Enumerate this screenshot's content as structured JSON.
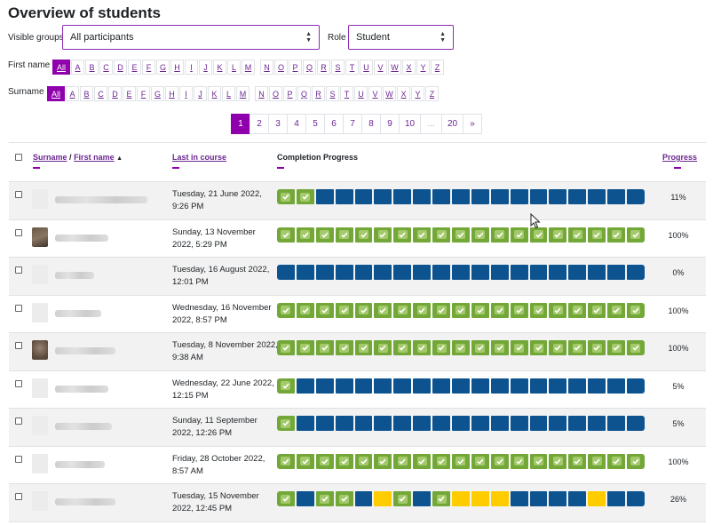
{
  "page": {
    "title": "Overview of students"
  },
  "filters": {
    "groups_label": "Visible groups",
    "groups_value": "All participants",
    "role_label": "Role",
    "role_value": "Student"
  },
  "initials": {
    "firstname_label": "First name",
    "surname_label": "Surname",
    "all_label": "All",
    "letters": [
      "A",
      "B",
      "C",
      "D",
      "E",
      "F",
      "G",
      "H",
      "I",
      "J",
      "K",
      "L",
      "M",
      "N",
      "O",
      "P",
      "Q",
      "R",
      "S",
      "T",
      "U",
      "V",
      "W",
      "X",
      "Y",
      "Z"
    ]
  },
  "pagination": {
    "pages": [
      "1",
      "2",
      "3",
      "4",
      "5",
      "6",
      "7",
      "8",
      "9",
      "10",
      "...",
      "20",
      "»"
    ],
    "active": "1"
  },
  "table": {
    "col_surname": "Surname",
    "col_sep": "/",
    "col_firstname": "First name",
    "col_last": "Last in course",
    "col_completion": "Completion Progress",
    "col_progress": "Progress",
    "rows": [
      {
        "date": "Tuesday, 21 June 2022, 9:26 PM",
        "progress": "11%",
        "segments": "CCNNNNNNNNNNNNNNNNN",
        "avatar": "blank"
      },
      {
        "date": "Sunday, 13 November 2022, 5:29 PM",
        "progress": "100%",
        "segments": "CCCCCCCCCCCCCCCCCCC",
        "avatar": "photo"
      },
      {
        "date": "Tuesday, 16 August 2022, 12:01 PM",
        "progress": "0%",
        "segments": "NNNNNNNNNNNNNNNNNNN",
        "avatar": "blank"
      },
      {
        "date": "Wednesday, 16 November 2022, 8:57 PM",
        "progress": "100%",
        "segments": "CCCCCCCCCCCCCCCCCCC",
        "avatar": "blank"
      },
      {
        "date": "Tuesday, 8 November 2022, 9:38 AM",
        "progress": "100%",
        "segments": "CCCCCCCCCCCCCCCCCCC",
        "avatar": "photo"
      },
      {
        "date": "Wednesday, 22 June 2022, 12:15 PM",
        "progress": "5%",
        "segments": "CNNNNNNNNNNNNNNNNNN",
        "avatar": "blank"
      },
      {
        "date": "Sunday, 11 September 2022, 12:26 PM",
        "progress": "5%",
        "segments": "CNNNNNNNNNNNNNNNNNN",
        "avatar": "blank"
      },
      {
        "date": "Friday, 28 October 2022, 8:57 AM",
        "progress": "100%",
        "segments": "CCCCCCCCCCCCCCCCCCC",
        "avatar": "blank"
      },
      {
        "date": "Tuesday, 15 November 2022, 12:45 PM",
        "progress": "26%",
        "segments": "CNCCNSCNCSSSNNNNSNN",
        "avatar": "blank"
      }
    ]
  },
  "colors": {
    "accent": "#8f00ac",
    "complete": "#73a839",
    "not_started": "#0d5390",
    "submitted": "#ffcc00"
  }
}
